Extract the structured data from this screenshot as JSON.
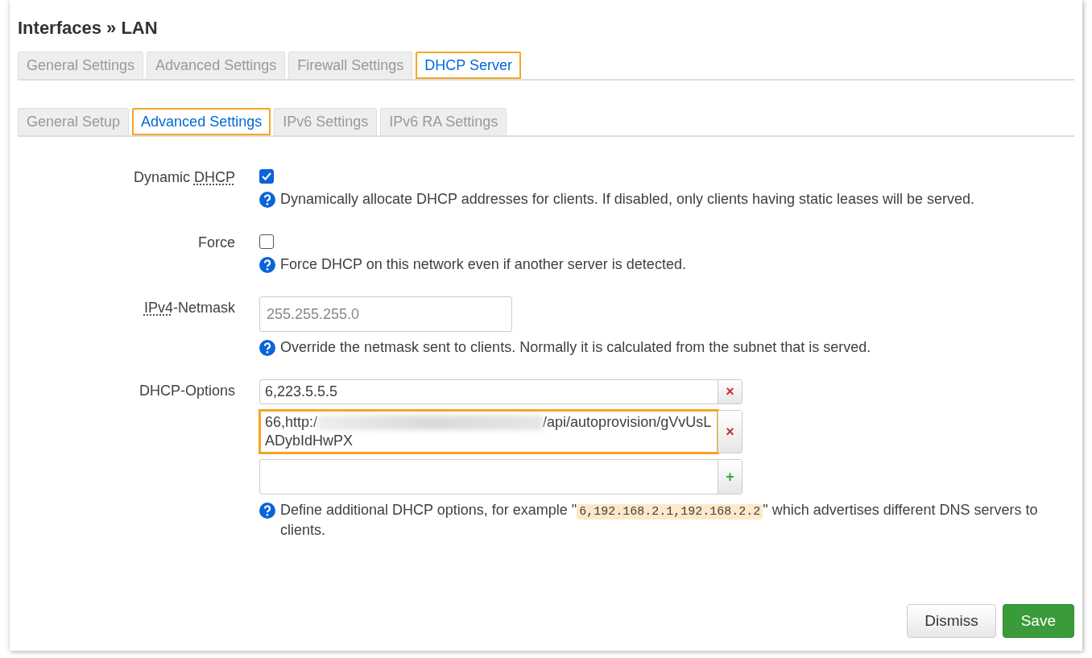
{
  "title": "Interfaces » LAN",
  "tabs": [
    {
      "label": "General Settings",
      "selected": false,
      "highlighted": false
    },
    {
      "label": "Advanced Settings",
      "selected": false,
      "highlighted": false
    },
    {
      "label": "Firewall Settings",
      "selected": false,
      "highlighted": false
    },
    {
      "label": "DHCP Server",
      "selected": true,
      "highlighted": true
    }
  ],
  "subtabs": [
    {
      "label": "General Setup",
      "selected": false,
      "highlighted": false
    },
    {
      "label": "Advanced Settings",
      "selected": true,
      "highlighted": true
    },
    {
      "label": "IPv6 Settings",
      "selected": false,
      "highlighted": false
    },
    {
      "label": "IPv6 RA Settings",
      "selected": false,
      "highlighted": false
    }
  ],
  "fields": [
    {
      "kind": "checkbox",
      "label": [
        {
          "text": "Dynamic "
        },
        {
          "abbr": "DHCP"
        }
      ],
      "checked": true,
      "help": "Dynamically allocate DHCP addresses for clients. If disabled, only clients having static leases will be served."
    },
    {
      "kind": "checkbox",
      "label": [
        {
          "text": "Force"
        }
      ],
      "checked": false,
      "help": "Force DHCP on this network even if another server is detected."
    },
    {
      "kind": "text",
      "label": [
        {
          "abbr": "IPv4"
        },
        {
          "text": "-Netmask"
        }
      ],
      "placeholder": "255.255.255.0",
      "help": "Override the netmask sent to clients. Normally it is calculated from the subnet that is served."
    },
    {
      "kind": "list",
      "label": [
        {
          "text": "DHCP-Options"
        }
      ],
      "items": [
        {
          "kind": "remove",
          "value_start": "6,223.5.5.5",
          "redacted": false,
          "highlighted": false,
          "action": "×"
        },
        {
          "kind": "remove",
          "value_start": "66,http:/",
          "redacted": true,
          "value_end": "/api/autoprovision/gVvUsLADybIdHwPX",
          "highlighted": true,
          "action": "×"
        },
        {
          "kind": "add",
          "highlighted": false,
          "action": "+"
        }
      ],
      "help_before": "Define additional DHCP options, for example \"",
      "help_code": "6,192.168.2.1,192.168.2.2",
      "help_after": "\" which advertises different DNS servers to clients."
    }
  ],
  "buttons": [
    {
      "label": "Dismiss",
      "kind": "secondary"
    },
    {
      "label": "Save",
      "kind": "primary"
    }
  ]
}
